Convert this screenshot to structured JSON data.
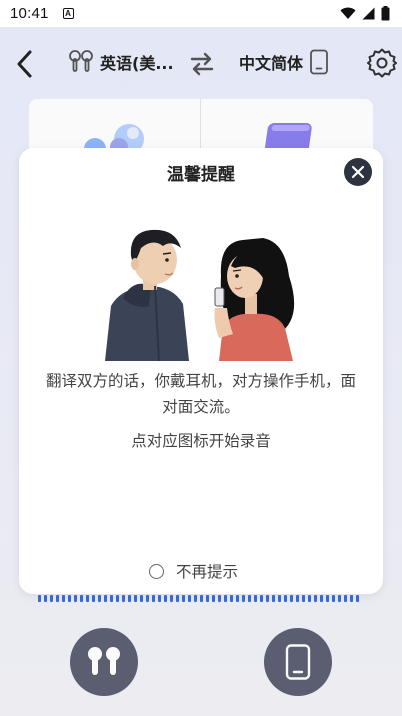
{
  "status_bar": {
    "time": "10:41",
    "notification_icon": "A"
  },
  "header": {
    "source_language": "英语(美...",
    "target_language": "中文简体",
    "back_icon": "chevron-left-icon",
    "swap_icon": "swap-arrows-icon",
    "settings_icon": "gear-icon",
    "earbuds_icon": "earbuds-icon",
    "phone_icon": "phone-icon"
  },
  "dialog": {
    "title": "温馨提醒",
    "description": "翻译双方的话，你戴耳机，对方操作手机，面对面交流。",
    "hint": "点对应图标开始录音",
    "dont_remind_label": "不再提示",
    "dont_remind_checked": false
  },
  "bottom": {
    "left_mode_icon": "earbuds-icon",
    "right_mode_icon": "phone-icon"
  },
  "colors": {
    "accent_blue": "#3a6fe0",
    "mode_button": "#5c6073",
    "close_button": "#2d3440"
  }
}
